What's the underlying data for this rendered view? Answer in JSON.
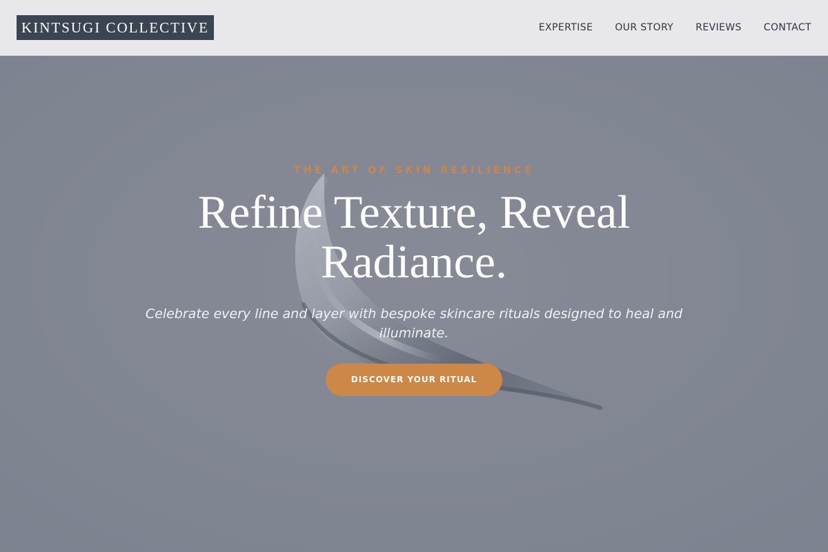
{
  "header": {
    "logo_text": "KINTSUGI COLLECTIVE",
    "nav": [
      {
        "label": "EXPERTISE"
      },
      {
        "label": "OUR STORY"
      },
      {
        "label": "REVIEWS"
      },
      {
        "label": "CONTACT"
      }
    ]
  },
  "hero": {
    "eyebrow": "THE ART OF SKIN RESILIENCE",
    "headline": "Refine Texture, Reveal Radiance.",
    "subline": "Celebrate every line and layer with bespoke skincare rituals designed to heal and illuminate.",
    "cta_label": "DISCOVER YOUR RITUAL",
    "background_image": "serum-smear-image"
  },
  "colors": {
    "header_bg": "#e8e8ea",
    "logo_bg": "#3a4453",
    "accent": "#cd8746",
    "hero_bg": "#868a95"
  }
}
